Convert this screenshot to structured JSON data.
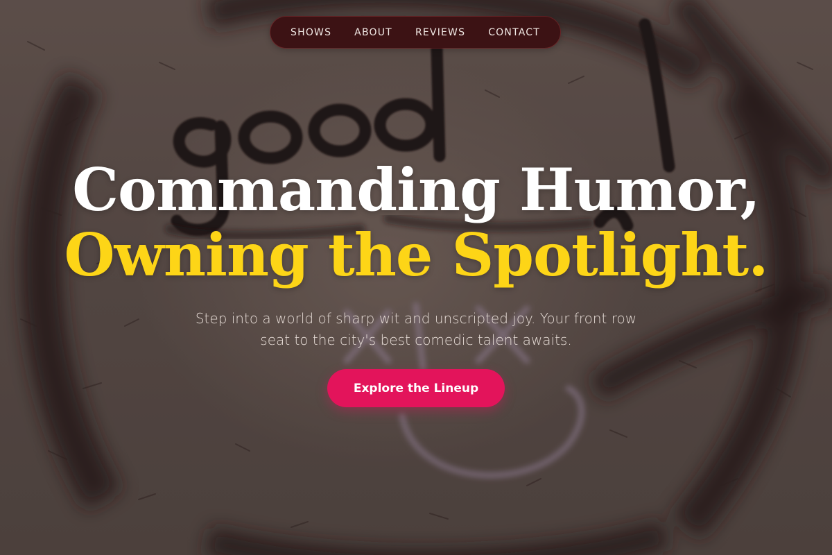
{
  "nav": {
    "items": [
      {
        "label": "SHOWS"
      },
      {
        "label": "ABOUT"
      },
      {
        "label": "REVIEWS"
      },
      {
        "label": "CONTACT"
      }
    ]
  },
  "hero": {
    "headline_line1": "Commanding Humor,",
    "headline_line2": "Owning the Spotlight.",
    "subtitle": "Step into a world of sharp wit and unscripted joy. Your front row seat to the city's best comedic talent awaits.",
    "cta_label": "Explore the Lineup",
    "background_image": "graffiti-wall-photo"
  },
  "colors": {
    "nav_background": "#3c1214",
    "headline_white": "#ffffff",
    "headline_accent": "#fdd517",
    "cta_background": "#e3145b",
    "subtitle_text": "#e6dcd6"
  }
}
